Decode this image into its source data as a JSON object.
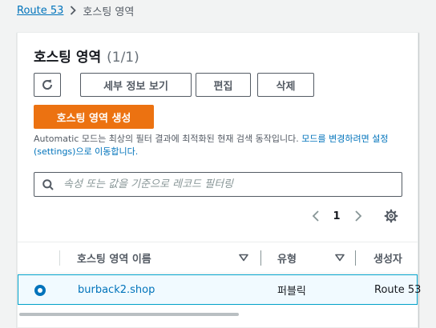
{
  "breadcrumb": {
    "root": "Route 53",
    "current": "호스팅 영역"
  },
  "panel": {
    "title": "호스팅 영역",
    "count": "(1/1)"
  },
  "actions": {
    "details": "세부 정보 보기",
    "edit": "편집",
    "delete": "삭제",
    "create": "호스팅 영역 생성"
  },
  "notice": {
    "text": "Automatic 모드는 최상의 필터 결과에 최적화된 현재 검색 동작입니다. ",
    "link": "모드를 변경하려면 설정(settings)으로 이동합니다."
  },
  "search": {
    "placeholder": "속성 또는 값을 기준으로 레코드 필터링"
  },
  "pagination": {
    "current_page": "1"
  },
  "table": {
    "columns": [
      "호스팅 영역 이름",
      "유형",
      "생성자"
    ],
    "rows": [
      {
        "name": "burback2.shop",
        "type": "퍼블릭",
        "creator": "Route 53",
        "selected": true
      }
    ]
  },
  "colors": {
    "primary": "#ec7211",
    "link": "#0073bb",
    "selected_row_bg": "#f1faff",
    "selected_row_border": "#00a1c9"
  }
}
